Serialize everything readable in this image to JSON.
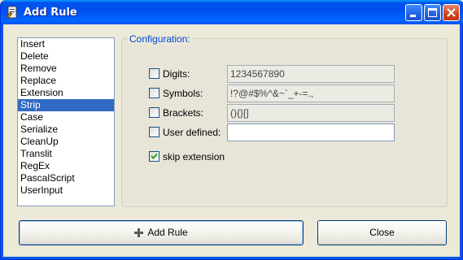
{
  "window": {
    "title": "Add Rule",
    "icon": "app-icon",
    "controls": [
      "minimize-icon",
      "maximize-icon",
      "close-icon"
    ]
  },
  "rules_list": {
    "items": [
      {
        "label": "Insert"
      },
      {
        "label": "Delete"
      },
      {
        "label": "Remove"
      },
      {
        "label": "Replace"
      },
      {
        "label": "Extension"
      },
      {
        "label": "Strip",
        "selected": true
      },
      {
        "label": "Case"
      },
      {
        "label": "Serialize"
      },
      {
        "label": "CleanUp"
      },
      {
        "label": "Translit"
      },
      {
        "label": "RegEx"
      },
      {
        "label": "PascalScript"
      },
      {
        "label": "UserInput"
      }
    ]
  },
  "configuration": {
    "label": "Configuration:",
    "digits": {
      "label": "Digits:",
      "checked": false,
      "value": "1234567890"
    },
    "symbols": {
      "label": "Symbols:",
      "checked": false,
      "value": "!?@#$%^&~`_+-=.,"
    },
    "brackets": {
      "label": "Brackets:",
      "checked": false,
      "value": "(){}[]"
    },
    "user_defined": {
      "label": "User defined:",
      "checked": false,
      "value": ""
    },
    "skip_extension": {
      "label": "skip extension",
      "checked": true
    }
  },
  "buttons": {
    "add_rule": "Add Rule",
    "close": "Close"
  },
  "colors": {
    "selection": "#316ac5",
    "group_label": "#0046d5",
    "titlebar": "#0050ee",
    "checkmark": "#21a121"
  }
}
